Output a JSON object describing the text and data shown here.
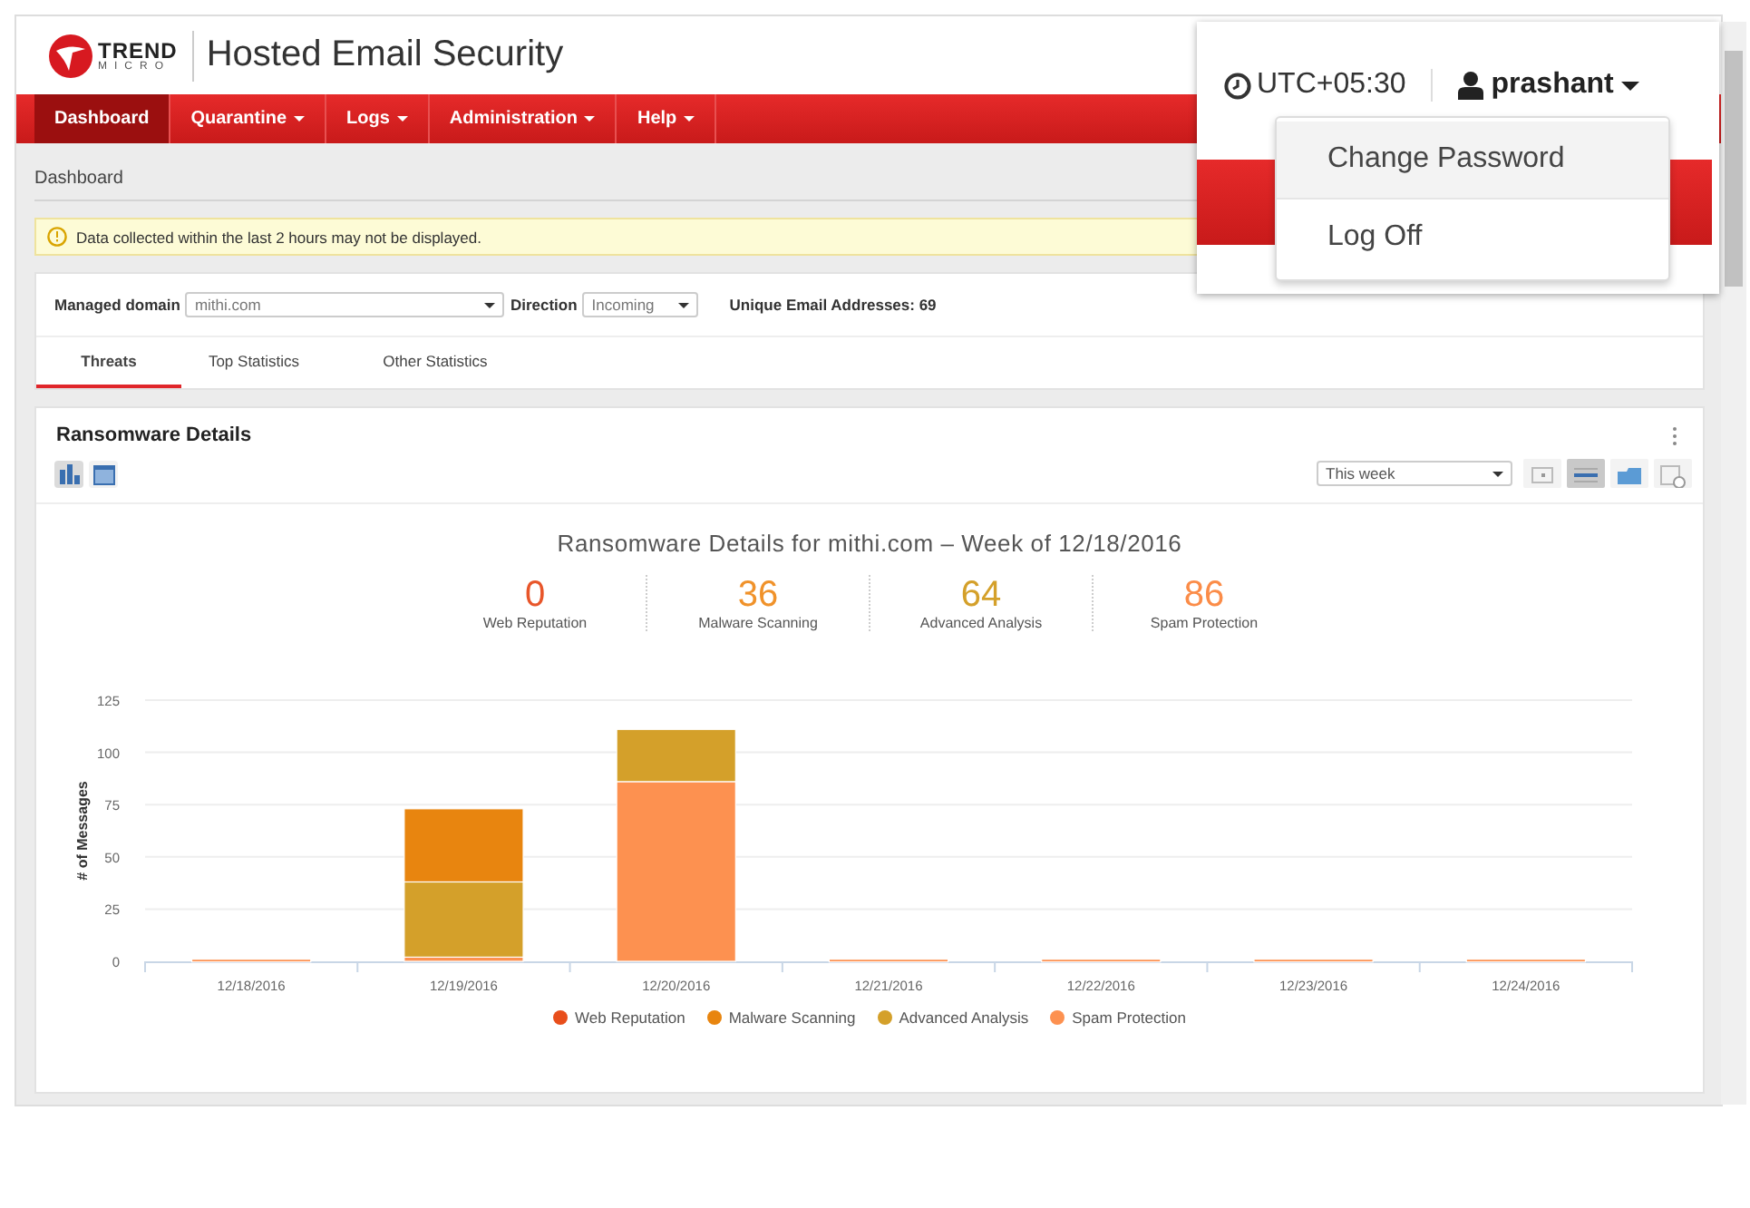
{
  "header": {
    "logo_text": "TREND",
    "logo_subtext": "MICRO",
    "product": "Hosted Email Security"
  },
  "nav": [
    {
      "label": "Dashboard",
      "selected": true,
      "has_menu": false
    },
    {
      "label": "Quarantine",
      "selected": false,
      "has_menu": true
    },
    {
      "label": "Logs",
      "selected": false,
      "has_menu": true
    },
    {
      "label": "Administration",
      "selected": false,
      "has_menu": true
    },
    {
      "label": "Help",
      "selected": false,
      "has_menu": true
    }
  ],
  "breadcrumb": "Dashboard",
  "notice": "Data collected within the last 2 hours may not be displayed.",
  "filters": {
    "domain_label": "Managed domain",
    "domain_value": "mithi.com",
    "direction_label": "Direction",
    "direction_value": "Incoming",
    "unique_label": "Unique Email Addresses: 69"
  },
  "tabs": [
    {
      "label": "Threats",
      "selected": true
    },
    {
      "label": "Top Statistics",
      "selected": false
    },
    {
      "label": "Other Statistics",
      "selected": false
    }
  ],
  "widget": {
    "title": "Ransomware Details",
    "view_buttons": [
      {
        "kind": "chart",
        "selected": true
      },
      {
        "kind": "table",
        "selected": false
      }
    ],
    "period": "This week",
    "layout_buttons": [
      {
        "kind": "single",
        "selected": false
      },
      {
        "kind": "rows",
        "selected": true
      },
      {
        "kind": "folder",
        "selected": false
      },
      {
        "kind": "history",
        "selected": false
      }
    ],
    "chart_title": "Ransomware Details for mithi.com – Week of 12/18/2016",
    "stats": [
      {
        "value": "0",
        "label": "Web Reputation",
        "color": "#e8562a"
      },
      {
        "value": "36",
        "label": "Malware Scanning",
        "color": "#f0922a"
      },
      {
        "value": "64",
        "label": "Advanced Analysis",
        "color": "#d4a02a"
      },
      {
        "value": "86",
        "label": "Spam Protection",
        "color": "#fb8c48"
      }
    ],
    "chart_data": {
      "type": "bar",
      "stacked": true,
      "grid": true,
      "ylabel": "# of Messages",
      "categories": [
        "12/18/2016",
        "12/19/2016",
        "12/20/2016",
        "12/21/2016",
        "12/22/2016",
        "12/23/2016",
        "12/24/2016"
      ],
      "ylim": [
        0,
        125
      ],
      "yticks": [
        0,
        25,
        50,
        75,
        100,
        125
      ],
      "series": [
        {
          "name": "Web Reputation",
          "color": "#e84e1b",
          "values": [
            0,
            0,
            0,
            0,
            0,
            0,
            0
          ]
        },
        {
          "name": "Malware Scanning",
          "color": "#e8850f",
          "values": [
            0,
            35,
            0,
            0,
            0,
            0,
            0
          ]
        },
        {
          "name": "Advanced Analysis",
          "color": "#d4a02a",
          "values": [
            0,
            36,
            25,
            0,
            0,
            0,
            0
          ]
        },
        {
          "name": "Spam Protection",
          "color": "#fd9150",
          "values": [
            1,
            2,
            86,
            1,
            1,
            1,
            1
          ]
        }
      ]
    }
  },
  "user_panel": {
    "timezone": "UTC+05:30",
    "user": "prashant",
    "menu": [
      {
        "label": "Change Password",
        "selected": true
      },
      {
        "label": "Log Off",
        "selected": false
      }
    ]
  }
}
